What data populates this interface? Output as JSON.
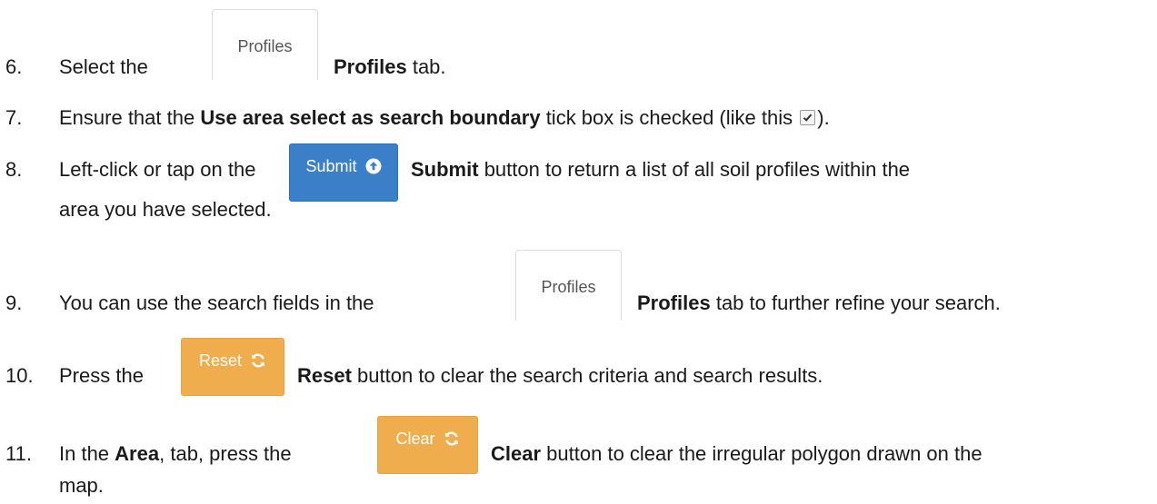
{
  "steps": [
    {
      "number": "6.",
      "before": "Select the",
      "image_label": "Profiles",
      "bold": "Profiles",
      "after": "tab."
    },
    {
      "number": "7.",
      "before": "Ensure that the",
      "bold": "Use area select as search boundary",
      "after": "tick box is checked (like this",
      "after_end": ")."
    },
    {
      "number": "8.",
      "before": "Left-click or tap on the",
      "image_label": "Submit",
      "bold": "Submit",
      "after": "button to return a list of all soil profiles within the",
      "continuation": "area you have selected."
    },
    {
      "number": "9.",
      "before": "You can use the search fields in the",
      "image_label": "Profiles",
      "bold": "Profiles",
      "after": "tab to further refine your search."
    },
    {
      "number": "10.",
      "before": "Press the",
      "image_label": "Reset",
      "bold": "Reset",
      "after": "button to clear the search criteria and search results."
    },
    {
      "number": "11.",
      "before": "In the",
      "bold_area": "Area",
      "middle": "tab, press the",
      "image_label": "Clear",
      "bold": "Clear",
      "after": "button to clear the irregular polygon drawn on the",
      "continuation": "map."
    }
  ],
  "icons": {
    "submit": "arrow-up-circle-icon",
    "reset": "refresh-icon",
    "clear": "refresh-icon",
    "checkbox": "checked-checkbox-icon"
  },
  "colors": {
    "submit_button": "#3a7fc8",
    "reset_button": "#f0ad4e",
    "clear_button": "#f0ad4e",
    "tab_border": "#dddddd"
  }
}
